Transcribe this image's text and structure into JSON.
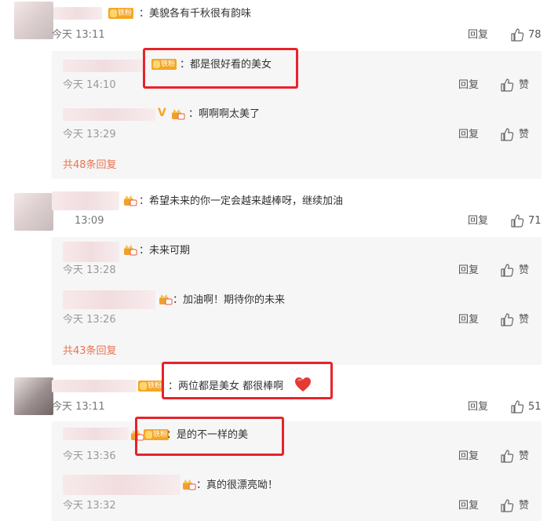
{
  "actions": {
    "reply": "回复",
    "like": "赞"
  },
  "comments": [
    {
      "text": "：美貌各有千秋很有韵味",
      "badge": "铁粉",
      "time": "今天 13:11",
      "likes": "78",
      "replies": [
        {
          "text": "：都是很好看的美女",
          "badge": "铁粉",
          "time": "今天 14:10"
        },
        {
          "text": "：啊啊啊太美了",
          "vmark": "V",
          "time": "今天 13:29"
        }
      ],
      "more": "共48条回复"
    },
    {
      "text": "：希望未来的你一定会越来越棒呀，继续加油",
      "time": "13:09",
      "likes": "71",
      "replies": [
        {
          "text": "：未来可期",
          "time": "今天 13:28"
        },
        {
          "text": "：加油啊！期待你的未来",
          "time": "今天 13:26"
        }
      ],
      "more": "共43条回复"
    },
    {
      "text": "：两位都是美女 都很棒啊",
      "badge": "铁粉",
      "time": "今天 13:11",
      "likes": "51",
      "replies": [
        {
          "text": "：是的不一样的美",
          "badge": "铁粉",
          "time": "今天 13:36"
        },
        {
          "text": "：真的很漂亮呦！",
          "time": "今天 13:32"
        }
      ]
    }
  ],
  "colors": {
    "highlight": "#e8232a",
    "more_link": "#eb7350",
    "fan_badge": "#f5a623",
    "reply_bg": "#f6f6f7"
  }
}
